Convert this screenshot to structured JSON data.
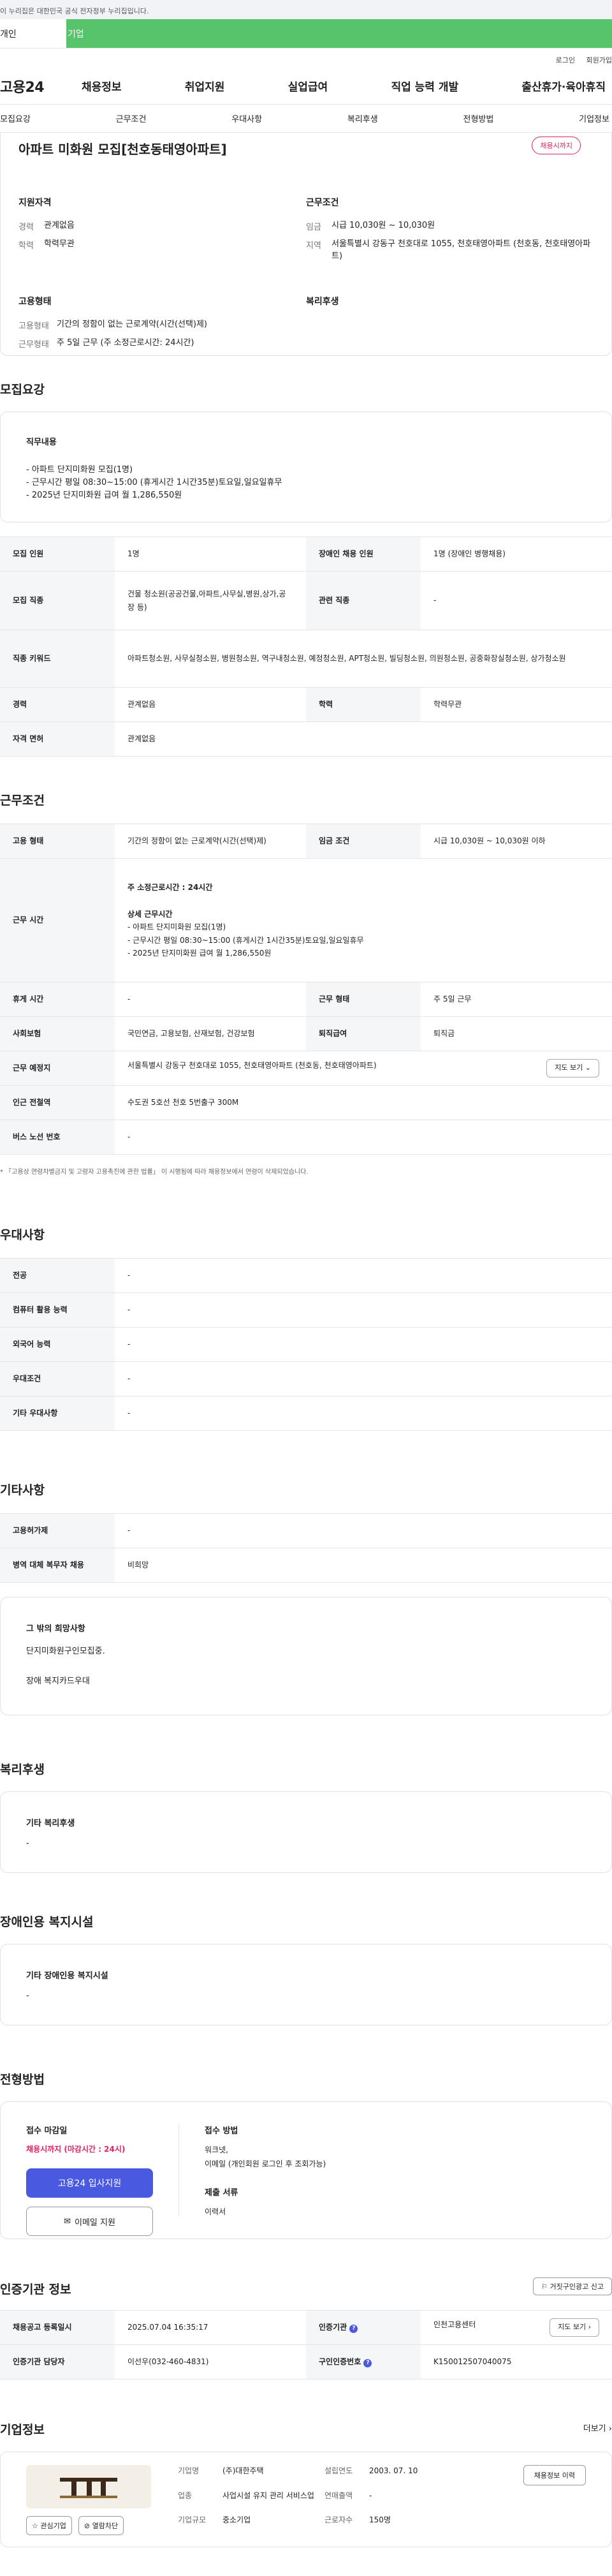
{
  "header": {
    "gov_banner": "이 누리집은 대한민국 공식 전자정부 누리집입니다.",
    "tab_personal": "개인",
    "tab_company": "기업",
    "login": "로그인",
    "join": "회원가입",
    "logo": "고용24",
    "menu": [
      "채용정보",
      "취업지원",
      "실업급여",
      "직업 능력 개발",
      "출산휴가·육아휴직"
    ]
  },
  "subnav": [
    "모집요강",
    "근무조건",
    "우대사항",
    "복리후생",
    "전형방법",
    "기업정보"
  ],
  "summary": {
    "title": "아파트 미화원 모집[천호동태영아파트]",
    "status_badge": "채용시까지",
    "qualification_heading": "지원자격",
    "career_label": "경력",
    "career_value": "관계없음",
    "education_label": "학력",
    "education_value": "학력무관",
    "conditions_heading": "근무조건",
    "wage_label": "임금",
    "wage_value": "시급 10,030원 ~ 10,030원",
    "region_label": "지역",
    "region_value": "서울특별시 강동구 천호대로 1055, 천호태영아파트 (천호동, 천호태영아파트)",
    "employment_heading": "고용형태",
    "emp_type_label": "고용형태",
    "emp_type_value": "기간의 정함이 없는 근로계약(시간(선택)제)",
    "work_form_label": "근무형태",
    "work_form_value": "주 5일 근무 (주 소정근로시간: 24시간)",
    "welfare_heading": "복리후생"
  },
  "recruit": {
    "title": "모집요강",
    "duty_heading": "직무내용",
    "duty_lines": [
      "- 아파트 단지미화원  모집(1명)",
      "- 근무시간 평일 08:30~15:00 (휴게시간 1시간35분)토요일,일요일휴무",
      "- 2025년 단지미화원 급여 월 1,286,550원"
    ],
    "rows": {
      "headcount_label": "모집 인원",
      "headcount_value": "1명",
      "disabled_label": "장애인 채용 인원",
      "disabled_value": "1명 (장애인 병행채용)",
      "job_label": "모집 직종",
      "job_value": "건물 청소원(공공건물,아파트,사무실,병원,상가,공장 등)",
      "related_label": "관련 직종",
      "related_value": "-",
      "keyword_label": "직종 키워드",
      "keyword_value": "아파트청소원, 사무실청소원, 병원청소원, 역구내청소원, 예정청소원, APT청소원, 빌딩청소원, 의원청소원, 공중화장실청소원, 상가청소원",
      "career_label": "경력",
      "career_value": "관계없음",
      "edu_label": "학력",
      "edu_value": "학력무관",
      "license_label": "자격 면허",
      "license_value": "관계없음"
    }
  },
  "conditions": {
    "title": "근무조건",
    "emp_type_label": "고용 형태",
    "emp_type_value": "기간의 정함이 없는 근로계약(시간(선택)제)",
    "wage_label": "임금 조건",
    "wage_value": "시급 10,030원 ~ 10,030원 이하",
    "hours_label": "근무 시간",
    "hours_week": "주 소정근로시간 : 24시간",
    "hours_detail_heading": "상세 근무시간",
    "hours_lines": [
      "- 아파트 단지미화원  모집(1명)",
      "- 근무시간 평일 08:30~15:00 (휴게시간 1시간35분)토요일,일요일휴무",
      "- 2025년 단지미화원 급여 월 1,286,550원"
    ],
    "break_label": "휴게 시간",
    "break_value": "-",
    "work_form_label": "근무 형태",
    "work_form_value": "주 5일 근무",
    "insurance_label": "사회보험",
    "insurance_value": "국민연금, 고용보험, 산재보험, 건강보험",
    "retire_label": "퇴직급여",
    "retire_value": "퇴직금",
    "location_label": "근무 예정지",
    "location_value": "서울특별시 강동구 천호대로 1055, 천호태영아파트 (천호동, 천호태영아파트)",
    "map_button": "지도 보기",
    "station_label": "인근 전철역",
    "station_value": "수도권 5호선 천호 5번출구 300M",
    "bus_label": "버스 노선 번호",
    "bus_value": "-",
    "note": "* 「고용상 연령차별금지 및 고령자 고용촉진에 관한 법률」 이 시행됨에 따라 채용정보에서 연령이 삭제되었습니다."
  },
  "preference": {
    "title": "우대사항",
    "rows": [
      {
        "label": "전공",
        "value": "-"
      },
      {
        "label": "컴퓨터 활용 능력",
        "value": "-"
      },
      {
        "label": "외국어 능력",
        "value": "-"
      },
      {
        "label": "우대조건",
        "value": "-"
      },
      {
        "label": "기타 우대사항",
        "value": "-"
      }
    ]
  },
  "etc": {
    "title": "기타사항",
    "rows": [
      {
        "label": "고용허가제",
        "value": "-"
      },
      {
        "label": "병역 대체 복무자 채용",
        "value": "비희망"
      }
    ],
    "other_heading": "그 밖의 희망사항",
    "other_line1": "단지미화원구인모집중.",
    "other_line2": "장애 복지카드우대"
  },
  "welfare": {
    "title": "복리후생",
    "heading": "기타 복리후생",
    "value": "-"
  },
  "disability": {
    "title": "장애인용 복지시설",
    "heading": "기타 장애인용 복지시설",
    "value": "-"
  },
  "selection": {
    "title": "전형방법",
    "deadline_heading": "접수 마감일",
    "deadline_value": "채용시까지 (마감시간 : 24시)",
    "apply_button": "고용24 입사지원",
    "email_button": "이메일 지원",
    "method_heading": "접수 방법",
    "method_line1": "워크넷,",
    "method_line2": "이메일 (개인회원 로그인 후 조회가능)",
    "docs_heading": "제출 서류",
    "docs_value": "이력서"
  },
  "agency": {
    "title": "인증기관 정보",
    "report_button": "거짓구인광고 신고",
    "reg_date_label": "채용공고 등록일시",
    "reg_date_value": "2025.07.04 16:35:17",
    "agency_label": "인증기관",
    "agency_value": "인천고용센터",
    "map_button": "지도 보기",
    "manager_label": "인증기관 담당자",
    "manager_value": "이선우(032-460-4831)",
    "id_label": "구인인증번호",
    "id_value": "K150012507040075"
  },
  "company": {
    "title": "기업정보",
    "more": "더보기",
    "interest_button": "관심기업",
    "block_button": "열람차단",
    "name_label": "기업명",
    "name_value": "(주)대한주택",
    "founded_label": "설립연도",
    "founded_value": "2003. 07. 10",
    "jobs_button": "채용정보 이력",
    "industry_label": "업종",
    "industry_value": "사업시설 유지 관리 서비스업",
    "revenue_label": "연매출액",
    "revenue_value": "-",
    "size_label": "기업규모",
    "size_value": "중소기업",
    "employees_label": "근로자수",
    "employees_value": "150명"
  }
}
